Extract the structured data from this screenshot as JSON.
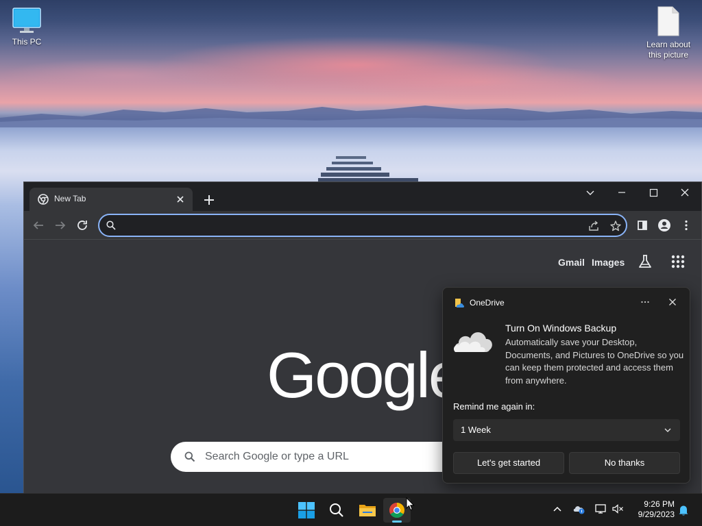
{
  "desktop": {
    "icons": [
      {
        "label": "This PC",
        "icon": "monitor-icon"
      },
      {
        "label": "Learn about this picture",
        "icon": "document-icon"
      }
    ]
  },
  "browser": {
    "tab_title": "New Tab",
    "omnibox_value": "",
    "top_links": {
      "gmail": "Gmail",
      "images": "Images"
    },
    "logo_text": "Google",
    "search_placeholder": "Search Google or type a URL",
    "colors": {
      "omnibox_focus": "#8ab4f8",
      "page_bg": "#35363a",
      "titlebar_bg": "#202124"
    }
  },
  "toast": {
    "app_name": "OneDrive",
    "headline": "Turn On Windows Backup",
    "body": "Automatically save your Desktop, Documents, and Pictures to OneDrive so you can keep them protected and access them from anywhere.",
    "remind_label": "Remind me again in:",
    "remind_selected": "1 Week",
    "primary_button": "Let's get started",
    "secondary_button": "No thanks"
  },
  "taskbar": {
    "apps": [
      "start-icon",
      "search-icon",
      "file-explorer-icon",
      "chrome-icon"
    ],
    "tray": [
      "chevron-up-icon",
      "onedrive-icon",
      "network-icon",
      "volume-muted-icon",
      "notification-bell-icon"
    ],
    "time": "9:26 PM",
    "date": "9/29/2023",
    "accent": "#60cdff"
  }
}
